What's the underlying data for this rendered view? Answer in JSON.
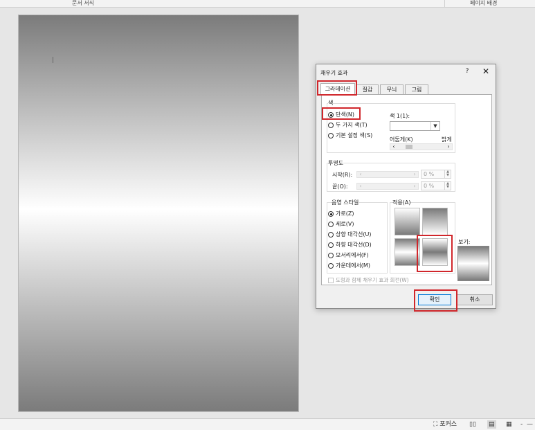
{
  "ribbon": {
    "group_left": "문서 서식",
    "group_right": "페이지 배경"
  },
  "dialog": {
    "title": "채우기 효과",
    "help": "?",
    "close": "✕",
    "tabs": [
      {
        "label": "그라데이션",
        "selected": true
      },
      {
        "label": "질감",
        "selected": false
      },
      {
        "label": "무늬",
        "selected": false
      },
      {
        "label": "그림",
        "selected": false
      }
    ],
    "color_section": {
      "label": "색",
      "options": [
        {
          "label": "단색(N)",
          "selected": true
        },
        {
          "label": "두 가지 색(T)",
          "selected": false
        },
        {
          "label": "기본 설정 색(S)",
          "selected": false
        }
      ],
      "color1_label": "색 1(1):",
      "dark_label": "어둡게(K)",
      "light_label": "밝게",
      "shade_slider": 0.22
    },
    "transparency": {
      "label": "투명도",
      "from_label": "시작(R):",
      "to_label": "끝(O):",
      "from_value": "0 %",
      "to_value": "0 %"
    },
    "shading": {
      "label": "음영 스타일",
      "options": [
        {
          "label": "가로(Z)",
          "selected": true
        },
        {
          "label": "세로(V)",
          "selected": false
        },
        {
          "label": "상향 대각선(U)",
          "selected": false
        },
        {
          "label": "하향 대각선(D)",
          "selected": false
        },
        {
          "label": "모서리에서(F)",
          "selected": false
        },
        {
          "label": "가운데에서(M)",
          "selected": false
        }
      ]
    },
    "variants_label": "적용(A)",
    "preview_label": "보기:",
    "rotate_checkbox": "도형과 함께 채우기 효과 회전(W)",
    "ok_label": "확인",
    "cancel_label": "취소"
  },
  "statusbar": {
    "focus_label": "포커스",
    "read_mode_icon": "book-icon",
    "print_layout_icon": "page-icon",
    "web_layout_icon": "web-icon",
    "zoom_minus": "-",
    "zoom_track": "—"
  },
  "highlight_color": "#d0262b"
}
